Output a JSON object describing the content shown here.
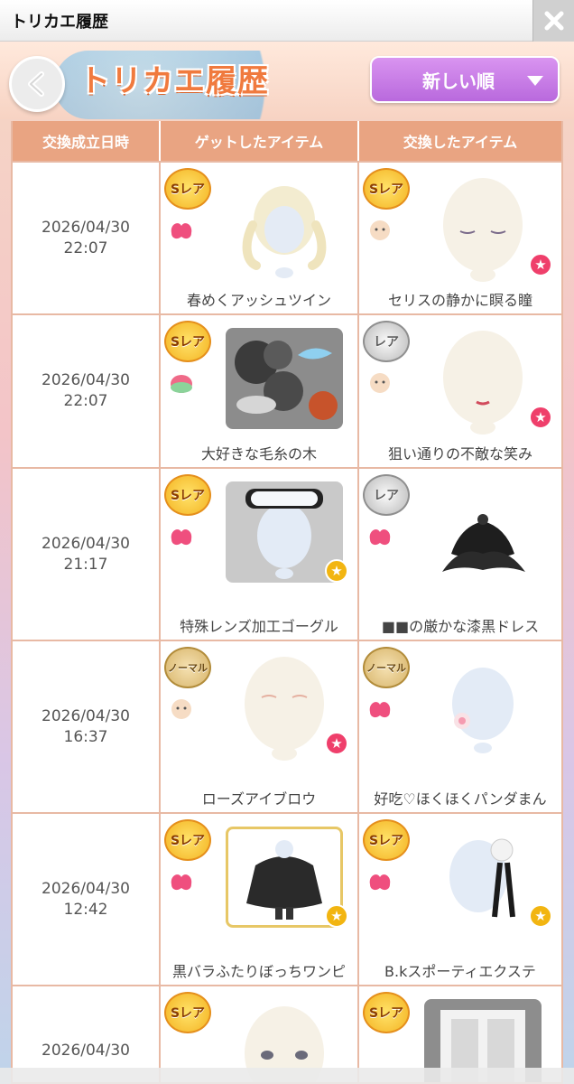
{
  "window": {
    "title": "トリカエ履歴"
  },
  "header": {
    "title": "トリカエ履歴",
    "sort_label": "新しい順"
  },
  "table": {
    "columns": [
      "交換成立日時",
      "ゲットしたアイテム",
      "交換したアイテム"
    ],
    "rows": [
      {
        "date": "2026/04/30",
        "time": "22:07",
        "got": {
          "rarity": "Sレア",
          "name": "春めくアッシュツイン",
          "kind": "hair"
        },
        "gave": {
          "rarity": "Sレア",
          "name": "セリスの静かに瞑る瞳",
          "kind": "eyes"
        }
      },
      {
        "date": "2026/04/30",
        "time": "22:07",
        "got": {
          "rarity": "Sレア",
          "name": "大好きな毛糸の木",
          "kind": "yarn"
        },
        "gave": {
          "rarity": "レア",
          "name": "狙い通りの不敵な笑み",
          "kind": "mouth"
        }
      },
      {
        "date": "2026/04/30",
        "time": "21:17",
        "got": {
          "rarity": "Sレア",
          "name": "特殊レンズ加工ゴーグル",
          "kind": "goggle"
        },
        "gave": {
          "rarity": "レア",
          "name": "■■の厳かな漆黒ドレス",
          "kind": "dress"
        }
      },
      {
        "date": "2026/04/30",
        "time": "16:37",
        "got": {
          "rarity": "ノーマル",
          "name": "ローズアイブロウ",
          "kind": "brow"
        },
        "gave": {
          "rarity": "ノーマル",
          "name": "好吃♡ほくほくパンダまん",
          "kind": "panda"
        }
      },
      {
        "date": "2026/04/30",
        "time": "12:42",
        "got": {
          "rarity": "Sレア",
          "name": "黒バラふたりぼっちワンピ",
          "kind": "onepiece"
        },
        "gave": {
          "rarity": "Sレア",
          "name": "B.kスポーティエクステ",
          "kind": "ext"
        }
      },
      {
        "date": "2026/04/30",
        "time": "",
        "got": {
          "rarity": "Sレア",
          "name": "",
          "kind": "face"
        },
        "gave": {
          "rarity": "Sレア",
          "name": "",
          "kind": "door"
        }
      }
    ]
  },
  "colors": {
    "accent": "#e9a482",
    "sort": "#c57ce6",
    "title": "#f07a3e"
  }
}
